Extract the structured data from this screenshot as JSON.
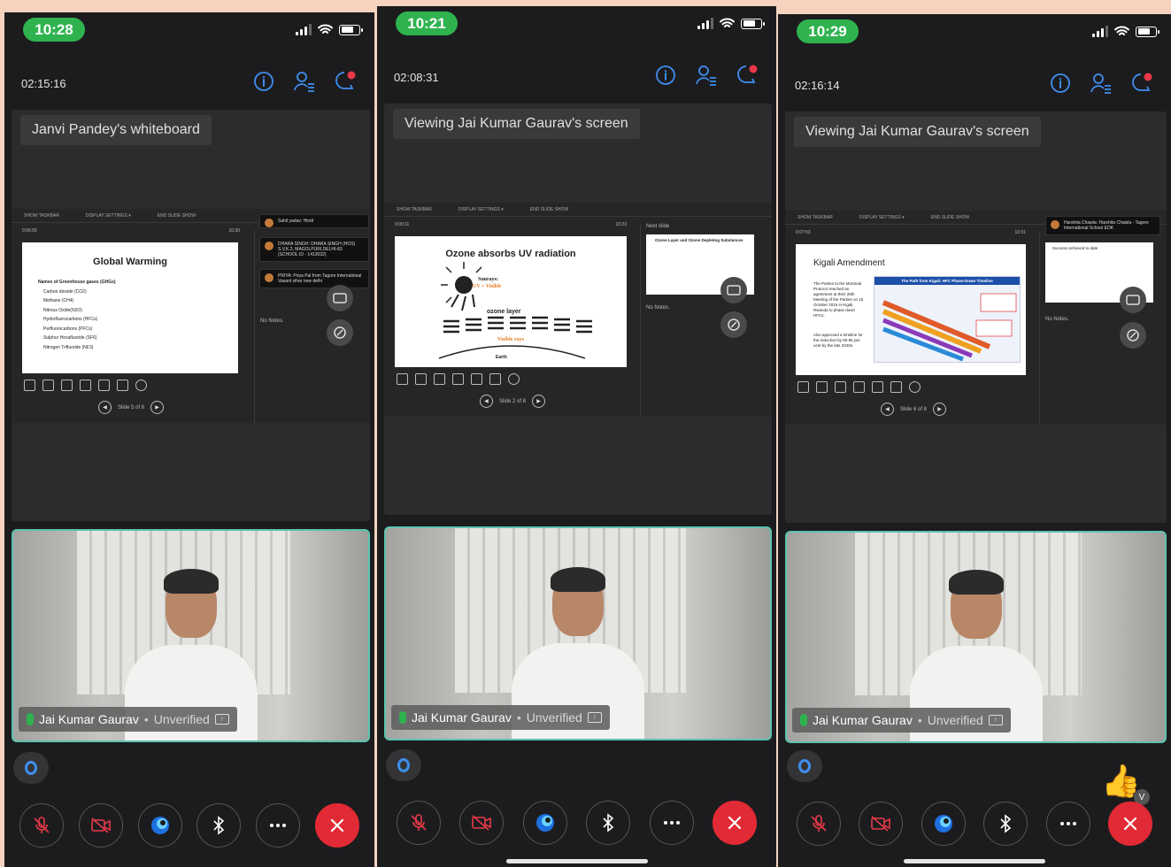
{
  "panels": [
    {
      "clock": "10:28",
      "elapsed": "02:15:16",
      "share_label": "Janvi Pandey's whiteboard",
      "strip": {
        "taskbar": "SHOW TASKBAR",
        "display": "DISPLAY SETTINGS ▾",
        "end": "END SLIDE SHOW"
      },
      "slide_timer": "0:06:55",
      "slide_clock": "10:30",
      "slide_title": "Global Warming",
      "slide_bullets": [
        "Names of Greenhouse gases (GHGs)",
        "Carbon dioxide (CO2)",
        "Methane (CH4)",
        "Nitrous Oxide(N2O)",
        "Hydrofluorocarbons (HFCs)",
        "Perfluorocarbons (PFCs)",
        "Sulphur Hexafluoride (SF6)",
        "Nitrogen Trifluoride (NF3)"
      ],
      "slide_counter": "Slide 5 of 8",
      "notes": "No Notes.",
      "chats": [
        {
          "text": "Sahil yadav: Hindi"
        },
        {
          "text": "DHARA SINGH: DHARA SINGH (HOS) S.V.K.2, MAGOLPURI,DELHI-83 (SCHOOL ID - 1413032)"
        },
        {
          "text": "PRIYA: Priya Pal from Tagore International Vasant vihar new delhi"
        }
      ],
      "participant_name": "Jai Kumar Gaurav",
      "verification": "Unverified"
    },
    {
      "clock": "10:21",
      "elapsed": "02:08:31",
      "share_label": "Viewing Jai Kumar Gaurav's screen",
      "strip": {
        "taskbar": "SHOW TASKBAR",
        "display": "DISPLAY SETTINGS ▾",
        "end": "END SLIDE SHOW"
      },
      "slide_timer": "0:00:11",
      "slide_clock": "10:23",
      "slide_title": "Ozone absorbs UV radiation",
      "diagram_labels": {
        "sunrays": "Sunrays:",
        "uv": "UV + Visible",
        "ozone": "ozone layer",
        "visible": "Visible rays",
        "earth": "Earth"
      },
      "next_slide_label": "Next slide",
      "next_slide_title": "Ozone Layer and Ozone Depleting Substances",
      "slide_counter": "Slide 2 of 8",
      "notes": "No Notes.",
      "participant_name": "Jai Kumar Gaurav",
      "verification": "Unverified"
    },
    {
      "clock": "10:29",
      "elapsed": "02:16:14",
      "share_label": "Viewing Jai Kumar Gaurav's screen",
      "strip": {
        "taskbar": "SHOW TASKBAR",
        "display": "DISPLAY SETTINGS ▾",
        "end": "END SLIDE SHOW"
      },
      "slide_timer": "0:07:53",
      "slide_clock": "10:31",
      "slide_title": "Kigali Amendment",
      "slide_body": "The Parties to the Montreal Protocol reached an agreement at their 28th Meeting of the Parties on 15 October 2016 in Kigali, Rwanda to phase down HFCs.",
      "slide_body2": "Also approved a timeline for the reduction by 80-85 per cent by the late 2040s.",
      "figure_title": "The Path from Kigali: HFC Phase-Down Timeline",
      "next_slide_label": "Next slide",
      "next_slide_title": "Success achieved to date",
      "chat": {
        "text": "Harshita Chawla: Harshita Chawla - Tagore International School EOK"
      },
      "slide_counter": "Slide 6 of 8",
      "notes": "No Notes.",
      "participant_name": "Jai Kumar Gaurav",
      "verification": "Unverified",
      "reaction_badge": "V"
    }
  ],
  "colors": {
    "accent": "#3f8ff0",
    "clock": "#2fb34f",
    "hangup": "#e12a35",
    "tile_border": "#5ac3b0"
  }
}
